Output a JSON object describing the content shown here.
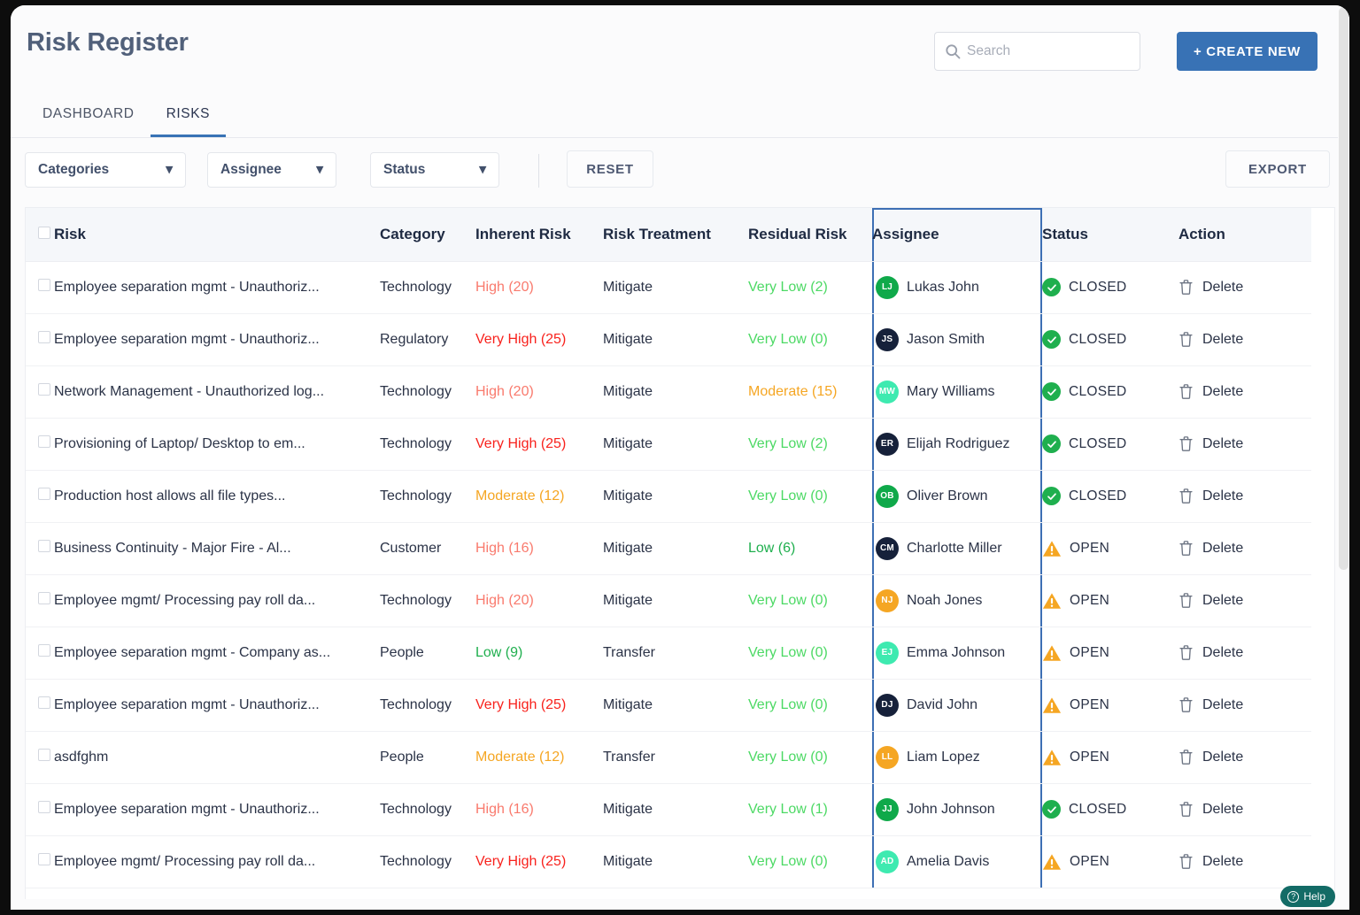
{
  "header": {
    "title": "Risk Register",
    "search": {
      "placeholder": "Search",
      "value": "",
      "icon": "search-icon"
    },
    "create_button": "+ CREATE NEW",
    "tabs": [
      {
        "label": "DASHBOARD",
        "active": false
      },
      {
        "label": "RISKS",
        "active": true
      }
    ]
  },
  "filters": {
    "categories": {
      "label": "Categories",
      "caret": "chevron-down-icon"
    },
    "assignee": {
      "label": "Assignee",
      "caret": "chevron-down-icon"
    },
    "status": {
      "label": "Status",
      "caret": "chevron-down-icon"
    },
    "reset_button": "RESET",
    "export_button": "EXPORT"
  },
  "table": {
    "columns": [
      "Risk",
      "Category",
      "Inherent Risk",
      "Risk Treatment",
      "Residual Risk",
      "Assignee",
      "Status",
      "Action"
    ],
    "highlighted_column": "Assignee",
    "highlight_color": "#3d6fb4",
    "action_label": "Delete",
    "rows": [
      {
        "risk": "Employee separation mgmt - Unauthoriz...",
        "category": "Technology",
        "inherent": "High (20)",
        "inherent_level": "high",
        "treatment": "Mitigate",
        "residual": "Very Low (2)",
        "residual_level": "vlow",
        "assignee": "Lukas John",
        "initials": "LJ",
        "avatar_color": "#0fa94a",
        "status": "CLOSED"
      },
      {
        "risk": "Employee separation mgmt - Unauthoriz...",
        "category": "Regulatory",
        "inherent": "Very High (25)",
        "inherent_level": "vhigh",
        "treatment": "Mitigate",
        "residual": "Very Low (0)",
        "residual_level": "vlow",
        "assignee": "Jason Smith",
        "initials": "JS",
        "avatar_color": "#16213a",
        "status": "CLOSED"
      },
      {
        "risk": "Network Management - Unauthorized log...",
        "category": "Technology",
        "inherent": "High (20)",
        "inherent_level": "high",
        "treatment": "Mitigate",
        "residual": "Moderate (15)",
        "residual_level": "mod",
        "assignee": "Mary Williams",
        "initials": "MW",
        "avatar_color": "#3eeab0",
        "status": "CLOSED"
      },
      {
        "risk": "Provisioning of Laptop/ Desktop to em...",
        "category": "Technology",
        "inherent": "Very High (25)",
        "inherent_level": "vhigh",
        "treatment": "Mitigate",
        "residual": "Very Low (2)",
        "residual_level": "vlow",
        "assignee": "Elijah Rodriguez",
        "initials": "ER",
        "avatar_color": "#16213a",
        "status": "CLOSED"
      },
      {
        "risk": "Production host allows all file types...",
        "category": "Technology",
        "inherent": "Moderate (12)",
        "inherent_level": "mod",
        "treatment": "Mitigate",
        "residual": "Very Low (0)",
        "residual_level": "vlow",
        "assignee": "Oliver Brown",
        "initials": "OB",
        "avatar_color": "#0fa94a",
        "status": "CLOSED"
      },
      {
        "risk": "Business Continuity - Major Fire - Al...",
        "category": "Customer",
        "inherent": "High (16)",
        "inherent_level": "high",
        "treatment": "Mitigate",
        "residual": "Low (6)",
        "residual_level": "low",
        "assignee": "Charlotte Miller",
        "initials": "CM",
        "avatar_color": "#16213a",
        "status": "OPEN"
      },
      {
        "risk": "Employee mgmt/ Processing pay roll da...",
        "category": "Technology",
        "inherent": "High (20)",
        "inherent_level": "high",
        "treatment": "Mitigate",
        "residual": "Very Low (0)",
        "residual_level": "vlow",
        "assignee": "Noah Jones",
        "initials": "NJ",
        "avatar_color": "#f5a623",
        "status": "OPEN"
      },
      {
        "risk": "Employee separation mgmt - Company as...",
        "category": "People",
        "inherent": "Low (9)",
        "inherent_level": "low",
        "treatment": "Transfer",
        "residual": "Very Low (0)",
        "residual_level": "vlow",
        "assignee": "Emma Johnson",
        "initials": "EJ",
        "avatar_color": "#3eeab0",
        "status": "OPEN"
      },
      {
        "risk": "Employee separation mgmt - Unauthoriz...",
        "category": "Technology",
        "inherent": "Very High (25)",
        "inherent_level": "vhigh",
        "treatment": "Mitigate",
        "residual": "Very Low (0)",
        "residual_level": "vlow",
        "assignee": "David John",
        "initials": "DJ",
        "avatar_color": "#16213a",
        "status": "OPEN"
      },
      {
        "risk": "asdfghm",
        "category": "People",
        "inherent": "Moderate (12)",
        "inherent_level": "mod",
        "treatment": "Transfer",
        "residual": "Very Low (0)",
        "residual_level": "vlow",
        "assignee": "Liam Lopez",
        "initials": "LL",
        "avatar_color": "#f5a623",
        "status": "OPEN"
      },
      {
        "risk": "Employee separation mgmt - Unauthoriz...",
        "category": "Technology",
        "inherent": "High (16)",
        "inherent_level": "high",
        "treatment": "Mitigate",
        "residual": "Very Low (1)",
        "residual_level": "vlow",
        "assignee": "John Johnson",
        "initials": "JJ",
        "avatar_color": "#0fa94a",
        "status": "CLOSED"
      },
      {
        "risk": "Employee mgmt/ Processing pay roll da...",
        "category": "Technology",
        "inherent": "Very High (25)",
        "inherent_level": "vhigh",
        "treatment": "Mitigate",
        "residual": "Very Low (0)",
        "residual_level": "vlow",
        "assignee": "Amelia Davis",
        "initials": "AD",
        "avatar_color": "#3eeab0",
        "status": "OPEN"
      }
    ]
  },
  "help_widget": {
    "label": "Help",
    "icon": "question-circle-icon",
    "color": "#136b66"
  },
  "severity_colors": {
    "vhigh": "#f8221d",
    "high": "#f97a6d",
    "mod": "#f5a623",
    "low": "#1faf4e",
    "vlow": "#4cd964"
  }
}
